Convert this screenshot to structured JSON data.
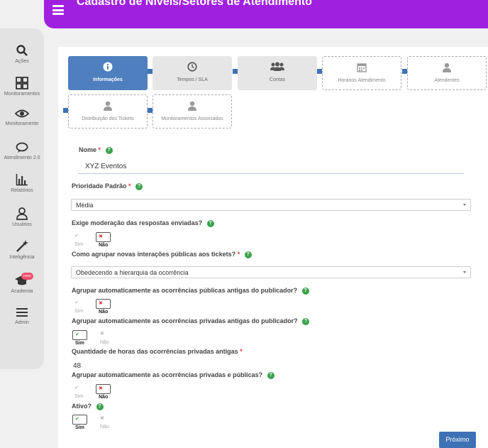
{
  "header": {
    "title": "Cadastro de Níveis/Setores de Atendimento"
  },
  "sidebar": {
    "items": [
      {
        "label": "Ações",
        "icon": "search-icon"
      },
      {
        "label": "Monitoramentos",
        "icon": "grid-icon"
      },
      {
        "label": "Monitoramento",
        "icon": "eye-icon"
      },
      {
        "label": "Atendimento 2.0",
        "icon": "chat-icon"
      },
      {
        "label": "Relatórios",
        "icon": "bar-chart-icon"
      },
      {
        "label": "Usuários",
        "icon": "user-icon"
      },
      {
        "label": "Inteligência",
        "icon": "magic-wand-icon"
      },
      {
        "label": "Academia",
        "icon": "graduation-cap-icon",
        "badge": "novo"
      },
      {
        "label": "Admin",
        "icon": "menu-icon"
      }
    ]
  },
  "steps": [
    {
      "label": "Informações",
      "icon": "info-icon",
      "state": "active"
    },
    {
      "label": "Tempos / SLA",
      "icon": "clock-icon",
      "state": "filled"
    },
    {
      "label": "Contas",
      "icon": "users-icon",
      "state": "filled"
    },
    {
      "label": "Horários Atendimento",
      "icon": "calendar-icon",
      "state": "dashed"
    },
    {
      "label": "Atendentes",
      "icon": "person-icon",
      "state": "dashed"
    },
    {
      "label": "Distribuição dos Tickets",
      "icon": "person-icon",
      "state": "dashed"
    },
    {
      "label": "Monitoramentos Associados",
      "icon": "person-icon",
      "state": "dashed"
    }
  ],
  "form": {
    "nome": {
      "label": "Nome",
      "required": "*",
      "value": "XYZ Eventos"
    },
    "prioridade": {
      "label": "Prioridade Padrão",
      "required": "*",
      "value": "Média"
    },
    "moderacao": {
      "label": "Exige moderação das respostas enviadas?",
      "yes": "Sim",
      "no": "Não",
      "selected": "no"
    },
    "agrupar": {
      "label": "Como agrupar novas interações públicas aos tickets?",
      "required": "*",
      "value": "Obedecendo a hierarquia da ocorrência"
    },
    "agrupar_publicas": {
      "label": "Agrupar automaticamente as ocorrências públicas antigas do publicador?",
      "yes": "Sim",
      "no": "Não",
      "selected": "no"
    },
    "agrupar_privadas": {
      "label": "Agrupar automaticamente as ocorrências privadas antigas do publicador?",
      "yes": "Sim",
      "no": "Não",
      "selected": "yes"
    },
    "horas": {
      "label": "Quantidade de horas das ocorrências privadas antigas",
      "required": "*",
      "value": "48"
    },
    "agrupar_ambas": {
      "label": "Agrupar automaticamente as ocorrências privadas e públicas?",
      "yes": "Sim",
      "no": "Não",
      "selected": "no"
    },
    "ativo": {
      "label": "Ativo?",
      "yes": "Sim",
      "no": "Não",
      "selected": "yes"
    }
  },
  "actions": {
    "next": "Próximo"
  }
}
